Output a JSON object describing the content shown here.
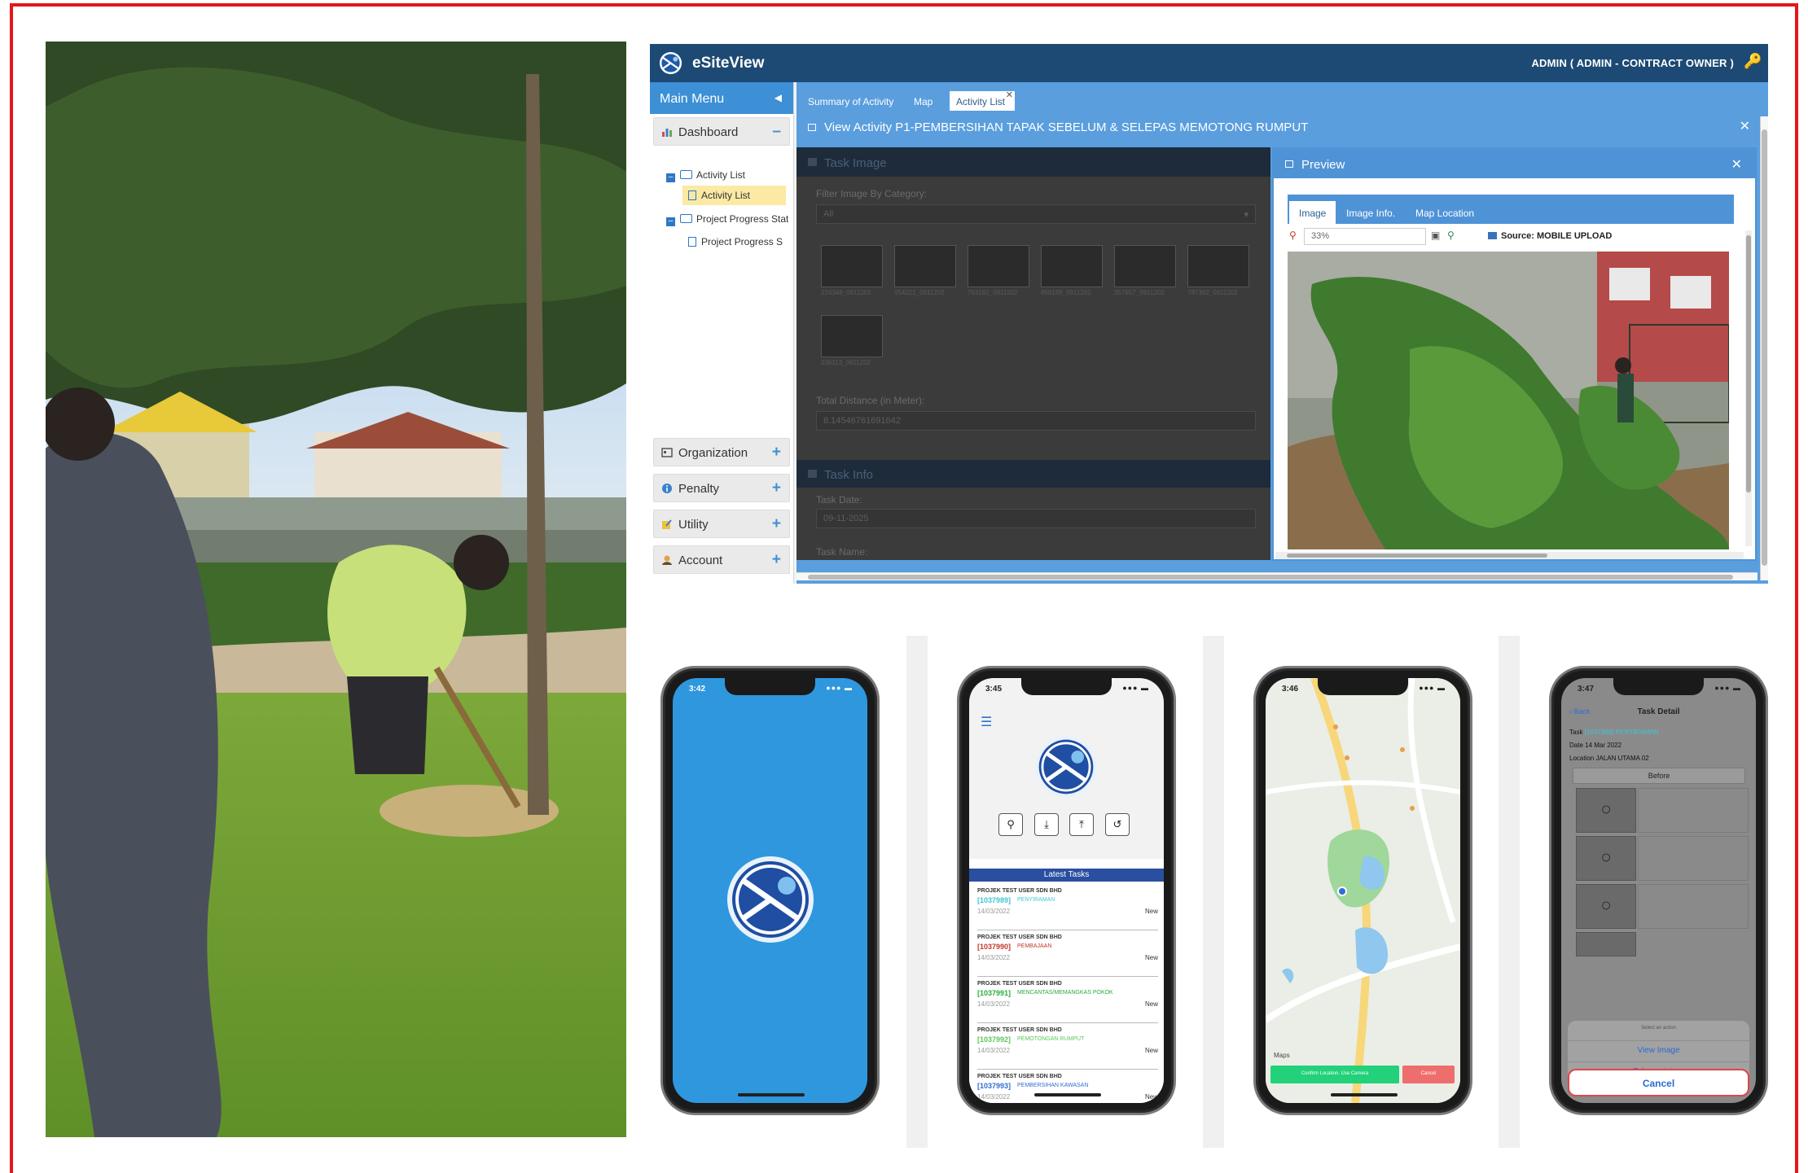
{
  "app": {
    "title": "eSiteView",
    "user": "ADMIN ( ADMIN - CONTRACT OWNER )",
    "colors": {
      "header": "#1d4a74",
      "accent": "#3d8fd6"
    }
  },
  "sidebar": {
    "main_menu": "Main Menu",
    "dashboard": "Dashboard",
    "tree": [
      {
        "label": "Activity List",
        "kind": "folder"
      },
      {
        "label": "Activity List",
        "kind": "page",
        "selected": true
      },
      {
        "label": "Project Progress Stati",
        "kind": "folder"
      },
      {
        "label": "Project Progress S",
        "kind": "page"
      }
    ],
    "groups": [
      "Organization",
      "Penalty",
      "Utility",
      "Account"
    ]
  },
  "tabs": [
    "Summary of Activity",
    "Map",
    "Activity List"
  ],
  "view": {
    "title": "View Activity P1-PEMBERSIHAN TAPAK SEBELUM & SELEPAS MEMOTONG RUMPUT"
  },
  "task_panel": {
    "image_header": "Task Image",
    "filter_label": "Filter Image By Category:",
    "filter_value": "All",
    "thumbnails": [
      "224348_0911202",
      "054221_0911202",
      "763182_0911202",
      "858189_0911202",
      "357657_0911202",
      "787392_0911202",
      "036113_0911202"
    ],
    "distance_label": "Total Distance (in Meter):",
    "distance_value": "8.14546761691642",
    "info_header": "Task Info",
    "date_label": "Task Date:",
    "date_value": "09-11-2025",
    "name_label": "Task Name:"
  },
  "preview": {
    "title": "Preview",
    "tabs": [
      "Image",
      "Image Info.",
      "Map Location"
    ],
    "zoom": "33%",
    "source": "Source: MOBILE UPLOAD"
  },
  "phones": {
    "splash": {
      "time": "3:42"
    },
    "home": {
      "time": "3:45",
      "latest_header": "Latest Tasks",
      "tasks": [
        {
          "company": "PROJEK TEST USER SDN BHD",
          "code": "[1037989]",
          "name": "PENYIRAMAN",
          "date": "14/03/2022",
          "status": "New",
          "color": "#3ec7d6"
        },
        {
          "company": "PROJEK TEST USER SDN BHD",
          "code": "[1037990]",
          "name": "PEMBAJAAN",
          "date": "14/03/2022",
          "status": "New",
          "color": "#c0392b"
        },
        {
          "company": "PROJEK TEST USER SDN BHD",
          "code": "[1037991]",
          "name": "MENCANTAS/MEMANGKAS POKOK",
          "date": "14/03/2022",
          "status": "New",
          "color": "#27ae3c"
        },
        {
          "company": "PROJEK TEST USER SDN BHD",
          "code": "[1037992]",
          "name": "PEMOTONGAN RUMPUT",
          "date": "14/03/2022",
          "status": "New",
          "color": "#5ac85a"
        },
        {
          "company": "PROJEK TEST USER SDN BHD",
          "code": "[1037993]",
          "name": "PEMBERSIHAN KAWASAN",
          "date": "14/03/2022",
          "status": "New",
          "color": "#2f6fd0"
        }
      ]
    },
    "map": {
      "time": "3:46",
      "confirm": "Confirm Location. Use Camera",
      "cancel": "Cancel",
      "attribution": "Maps"
    },
    "detail": {
      "time": "3:47",
      "back": "Back",
      "title": "Task Detail",
      "task_label": "Task",
      "task_value": "[1037989] PENYIRAMAN",
      "date_label": "Date",
      "date_value": "14 Mar 2022",
      "location_label": "Location",
      "location_value": "JALAN UTAMA 02",
      "section": "Before",
      "select_action": "Select an action",
      "view_image": "View Image",
      "take_picture": "Take a picture",
      "cancel": "Cancel"
    }
  }
}
